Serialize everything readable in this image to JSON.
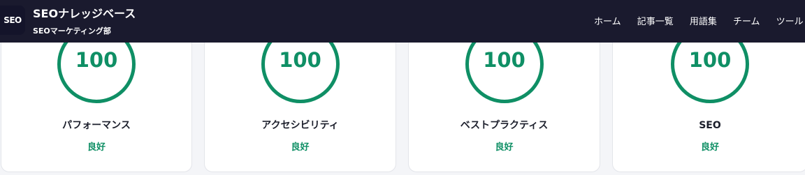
{
  "header": {
    "logo_text": "SEO",
    "title": "SEOナレッジベース",
    "subtitle": "SEOマーケティング部",
    "nav": [
      {
        "label": "ホーム"
      },
      {
        "label": "記事一覧"
      },
      {
        "label": "用語集"
      },
      {
        "label": "チーム"
      },
      {
        "label": "ツール"
      }
    ]
  },
  "metrics": [
    {
      "score": "100",
      "name": "パフォーマンス",
      "status": "良好"
    },
    {
      "score": "100",
      "name": "アクセシビリティ",
      "status": "良好"
    },
    {
      "score": "100",
      "name": "ベストプラクティス",
      "status": "良好"
    },
    {
      "score": "100",
      "name": "SEO",
      "status": "良好"
    }
  ],
  "colors": {
    "header_bg": "#1a1a2e",
    "good": "#0f8f65",
    "card_bg": "#ffffff",
    "page_bg": "#f4f5f8"
  }
}
